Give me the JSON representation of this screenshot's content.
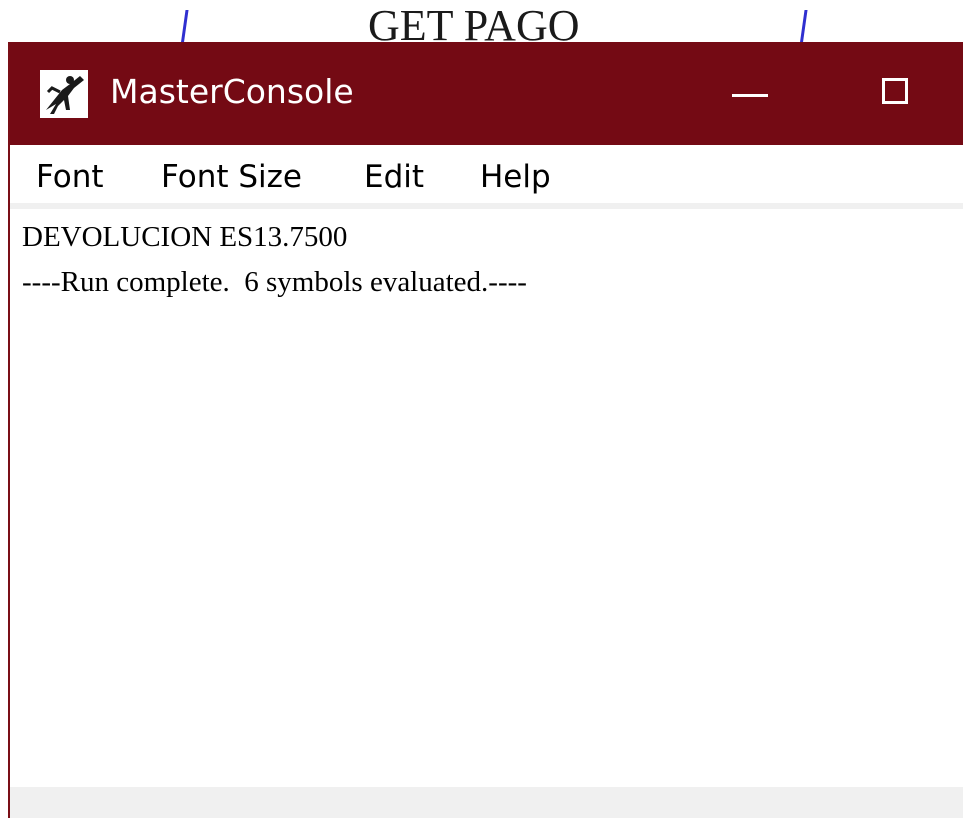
{
  "background": {
    "partial_text": "GET PAGO"
  },
  "window": {
    "title": "MasterConsole",
    "icon": "app-figure-icon",
    "colors": {
      "titlebar": "#740a14",
      "title_text": "#ffffff"
    }
  },
  "menu": {
    "items": [
      {
        "label": "Font"
      },
      {
        "label": "Font Size"
      },
      {
        "label": "Edit"
      },
      {
        "label": "Help"
      }
    ]
  },
  "console": {
    "lines": [
      "DEVOLUCION ES13.7500",
      "----Run complete.  6 symbols evaluated.----"
    ]
  }
}
